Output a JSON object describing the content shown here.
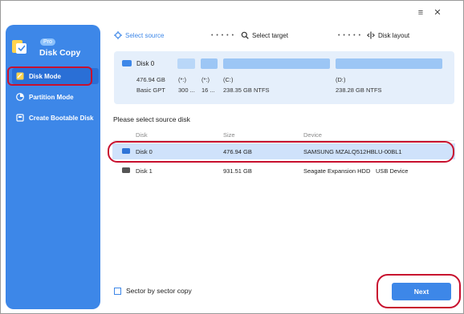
{
  "app": {
    "badge": "Pro",
    "title": "Disk Copy"
  },
  "sidebar": {
    "items": [
      {
        "label": "Disk Mode"
      },
      {
        "label": "Partition Mode"
      },
      {
        "label": "Create Bootable Disk"
      }
    ]
  },
  "steps": {
    "select_source": "Select source",
    "select_target": "Select target",
    "disk_layout": "Disk layout",
    "dots": "• • • • •"
  },
  "window_controls": {
    "menu": "≡",
    "close": "✕"
  },
  "disk_summary": {
    "name": "Disk 0",
    "size": "476.94 GB",
    "type": "Basic GPT",
    "partitions": [
      {
        "letter": "(*:)",
        "detail": "300 ..."
      },
      {
        "letter": "(*:)",
        "detail": "16 ..."
      },
      {
        "letter": "(C:)",
        "detail": "238.35 GB NTFS"
      },
      {
        "letter": "(D:)",
        "detail": "238.28 GB NTFS"
      }
    ]
  },
  "table": {
    "title": "Please select source disk",
    "headers": [
      "Disk",
      "Size",
      "Device"
    ],
    "rows": [
      {
        "disk": "Disk 0",
        "size": "476.94 GB",
        "device": "SAMSUNG MZALQ512HBLU-00BL1",
        "bus": ""
      },
      {
        "disk": "Disk 1",
        "size": "931.51 GB",
        "device": "Seagate  Expansion HDD",
        "bus": "USB Device"
      }
    ]
  },
  "footer": {
    "sector_copy": "Sector by sector copy",
    "next": "Next"
  },
  "colors": {
    "accent": "#3d87e8",
    "highlight": "#c8102e",
    "selected_row": "#cfe2fb"
  }
}
